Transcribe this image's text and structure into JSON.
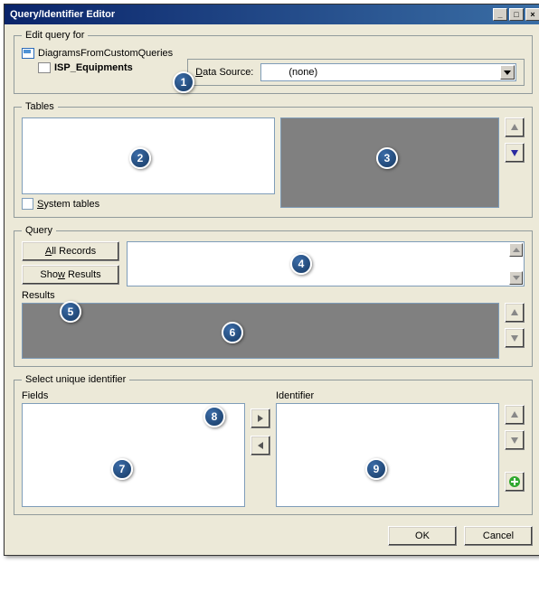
{
  "window": {
    "title": "Query/Identifier Editor"
  },
  "edit_query": {
    "legend": "Edit query for",
    "tree": {
      "root": "DiagramsFromCustomQueries",
      "child": "ISP_Equipments"
    },
    "data_source_label": "Data Source:",
    "data_source_value": "(none)"
  },
  "tables": {
    "legend": "Tables",
    "system_tables_label": "System tables"
  },
  "query": {
    "legend": "Query",
    "all_records_label": "All Records",
    "show_results_label": "Show Results",
    "results_label": "Results"
  },
  "sui": {
    "legend": "Select unique identifier",
    "fields_label": "Fields",
    "identifier_label": "Identifier"
  },
  "footer": {
    "ok": "OK",
    "cancel": "Cancel"
  },
  "callouts": {
    "c1": "1",
    "c2": "2",
    "c3": "3",
    "c4": "4",
    "c5": "5",
    "c6": "6",
    "c7": "7",
    "c8": "8",
    "c9": "9"
  }
}
